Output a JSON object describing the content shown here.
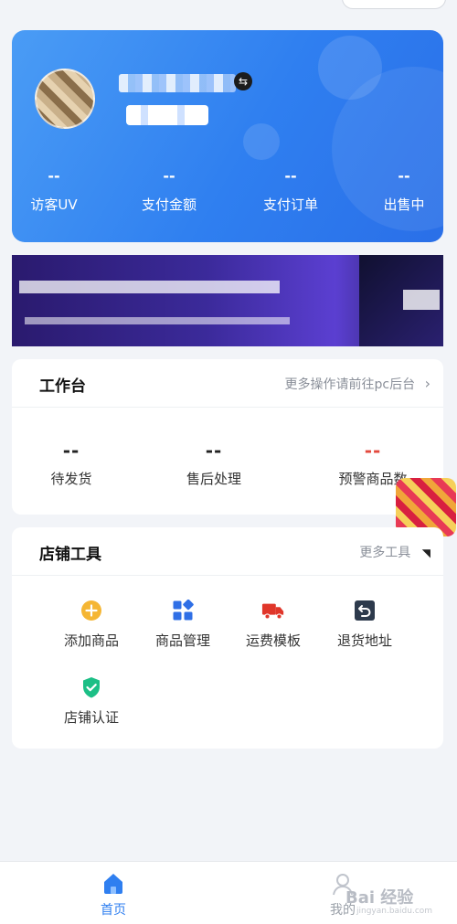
{
  "profile": {
    "stats": [
      {
        "value": "--",
        "label": "访客UV"
      },
      {
        "value": "--",
        "label": "支付金额"
      },
      {
        "value": "--",
        "label": "支付订单"
      },
      {
        "value": "--",
        "label": "出售中"
      }
    ]
  },
  "workbench": {
    "title": "工作台",
    "more": "更多操作请前往pc后台",
    "chevron": "›",
    "items": [
      {
        "value": "--",
        "label": "待发货"
      },
      {
        "value": "--",
        "label": "售后处理"
      },
      {
        "value": "--",
        "label": "预警商品数"
      }
    ]
  },
  "tools": {
    "title": "店铺工具",
    "more": "更多工具",
    "items": [
      {
        "label": "添加商品",
        "icon": "add-circle-icon"
      },
      {
        "label": "商品管理",
        "icon": "grid-apps-icon"
      },
      {
        "label": "运费模板",
        "icon": "truck-icon"
      },
      {
        "label": "退货地址",
        "icon": "return-arrow-icon"
      },
      {
        "label": "店铺认证",
        "icon": "shield-check-icon"
      }
    ]
  },
  "tabbar": {
    "home": "首页",
    "mine": "我的"
  },
  "watermark": {
    "brand": "Bai 经验",
    "url": "jingyan.baidu.com"
  },
  "colors": {
    "primary": "#2f7ff0",
    "warning": "#e3493d",
    "add": "#f5b634",
    "manage": "#2f6fe6",
    "truck": "#e0362a",
    "return": "#2d3a4c",
    "shield": "#1cbf86"
  }
}
